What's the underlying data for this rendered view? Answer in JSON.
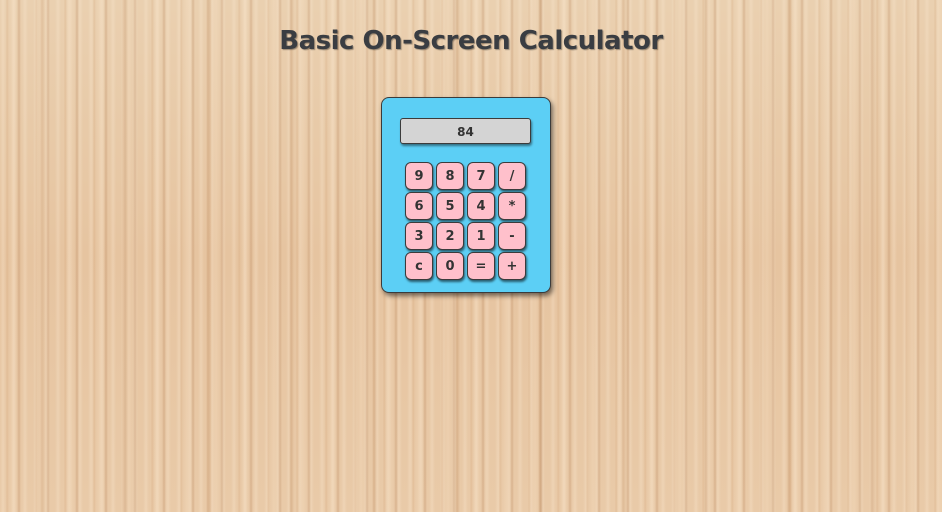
{
  "page": {
    "title": "Basic On-Screen Calculator"
  },
  "calculator": {
    "display_value": "84",
    "keys": [
      [
        "9",
        "8",
        "7",
        "/"
      ],
      [
        "6",
        "5",
        "4",
        "*"
      ],
      [
        "3",
        "2",
        "1",
        "-"
      ],
      [
        "c",
        "0",
        "=",
        "+"
      ]
    ]
  },
  "colors": {
    "calculator_body": "#5ccff5",
    "display_bg": "#d4d4d4",
    "key_bg": "#ffc0cb",
    "title_text": "#3a3d42"
  }
}
